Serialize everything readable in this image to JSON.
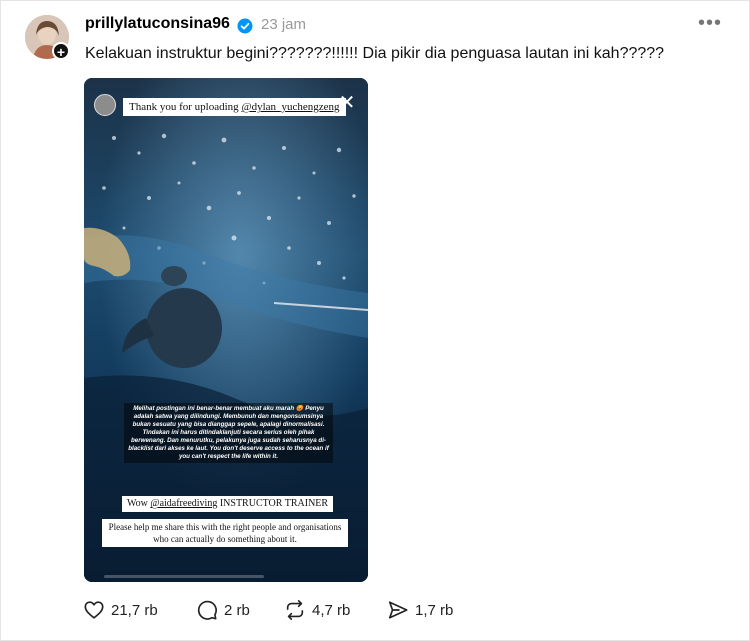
{
  "post": {
    "username": "prillylatuconsina96",
    "time": "23 jam",
    "more_label": "•••",
    "caption": "Kelakuan instruktur begini???????!!!!!! Dia pikir dia penguasa lautan ini kah?????"
  },
  "story": {
    "banner_prefix": "Thank you for uploading ",
    "banner_mention": "@dylan_yuchengzeng",
    "close_glyph": "✕",
    "overlay_text": "Melihat postingan ini benar-benar membuat aku marah 😡 Penyu adalah satwa yang dilindungi. Membunuh dan mengonsumsinya bukan sesuatu yang bisa dianggap sepele, apalagi dinormalisasi. Tindakan ini harus ditindaklanjuti secara serius oleh pihak berwenang. Dan menurutku, pelakunya juga sudah seharusnya di-blacklist dari akses ke laut. You don't deserve access to the ocean if you can't respect the life within it.",
    "credit_prefix": "Wow ",
    "credit_mention": "@aidafreediving",
    "credit_suffix": " INSTRUCTOR TRAINER",
    "note": "Please help me share this with the right people and organisations who can actually do something about it."
  },
  "actions": {
    "likes": "21,7 rb",
    "comments": "2 rb",
    "reposts": "4,7 rb",
    "shares": "1,7 rb"
  },
  "colors": {
    "verified": "#0095f6",
    "muted_text": "#999999"
  },
  "icons": [
    "avatar-plus-icon",
    "verified-icon",
    "more-icon",
    "close-icon",
    "heart-icon",
    "comment-icon",
    "repost-icon",
    "share-icon"
  ]
}
